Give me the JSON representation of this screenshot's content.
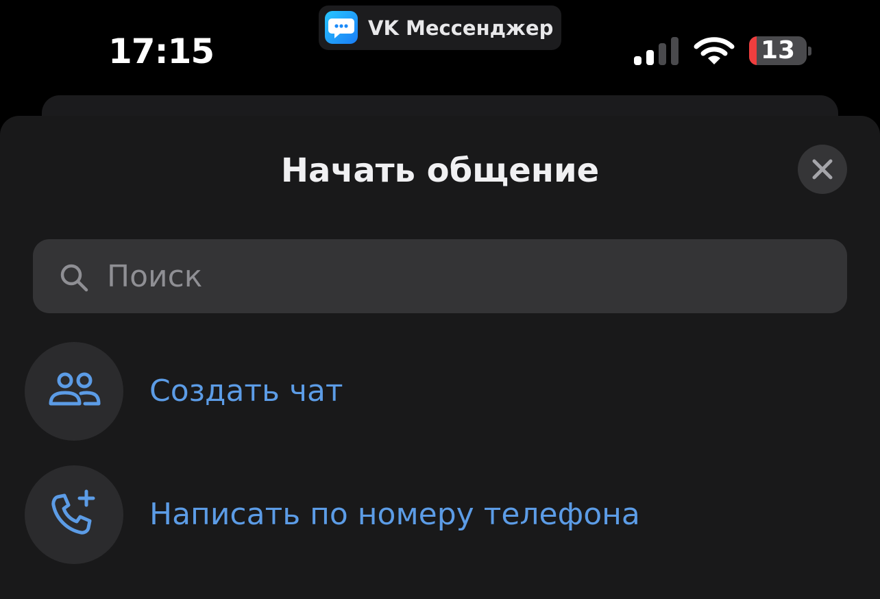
{
  "status_bar": {
    "time": "17:15",
    "app_name": "VK Мессенджер",
    "battery_level": "13",
    "battery_fraction": 0.13,
    "app_icon": "chat-bubble-icon",
    "signal_icon": "cellular-signal-icon",
    "wifi_icon": "wifi-icon"
  },
  "sheet": {
    "title": "Начать общение",
    "close_icon": "close-icon"
  },
  "search": {
    "placeholder": "Поиск",
    "icon": "search-icon"
  },
  "actions": [
    {
      "label": "Создать чат",
      "icon": "group-users-icon"
    },
    {
      "label": "Написать по номеру телефона",
      "icon": "phone-plus-icon"
    }
  ],
  "colors": {
    "background": "#000000",
    "sheet": "#19191a",
    "accent": "#5c9ce6",
    "battery_low": "#ef3e3e"
  }
}
